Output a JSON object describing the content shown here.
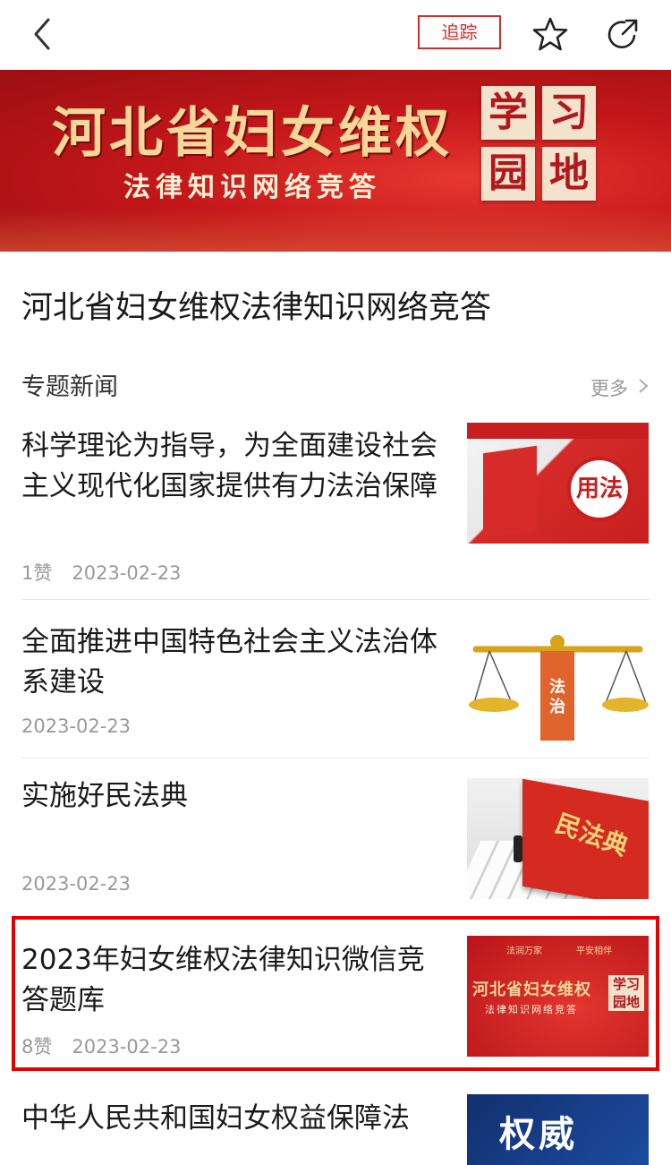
{
  "header": {
    "track_label": "追踪",
    "icons": [
      "back-arrow-icon",
      "star-icon",
      "share-icon"
    ]
  },
  "banner": {
    "headline": "河北省妇女维权",
    "subline": "法律知识网络竞答",
    "badge_chars": [
      "学",
      "习",
      "园",
      "地"
    ]
  },
  "page_title": "河北省妇女维权法律知识网络竞答",
  "section": {
    "label": "专题新闻",
    "more_label": "更多"
  },
  "articles": [
    {
      "title": "科学理论为指导，为全面建设社会主义现代化国家提供有力法治保障",
      "likes": "1赞",
      "date": "2023-02-23",
      "thumb_text": "用法"
    },
    {
      "title": "全面推进中国特色社会主义法治体系建设",
      "likes": "",
      "date": "2023-02-23",
      "thumb_text": "法治"
    },
    {
      "title": "实施好民法典",
      "likes": "",
      "date": "2023-02-23",
      "thumb_text": "民法典"
    },
    {
      "title": "2023年妇女维权法律知识微信竞答题库",
      "likes": "8赞",
      "date": "2023-02-23",
      "thumb_text": "河北省妇女维权",
      "thumb_sub": "法律知识网络竞答",
      "thumb_top_left": "法润万家",
      "thumb_top_right": "平安相伴"
    },
    {
      "title": "中华人民共和国妇女权益保障法",
      "likes": "",
      "date": "",
      "thumb_text": "权威"
    }
  ],
  "colors": {
    "accent": "#c9302c",
    "highlight": "#e40000",
    "banner_red": "#c4171a",
    "meta_gray": "#999999"
  }
}
